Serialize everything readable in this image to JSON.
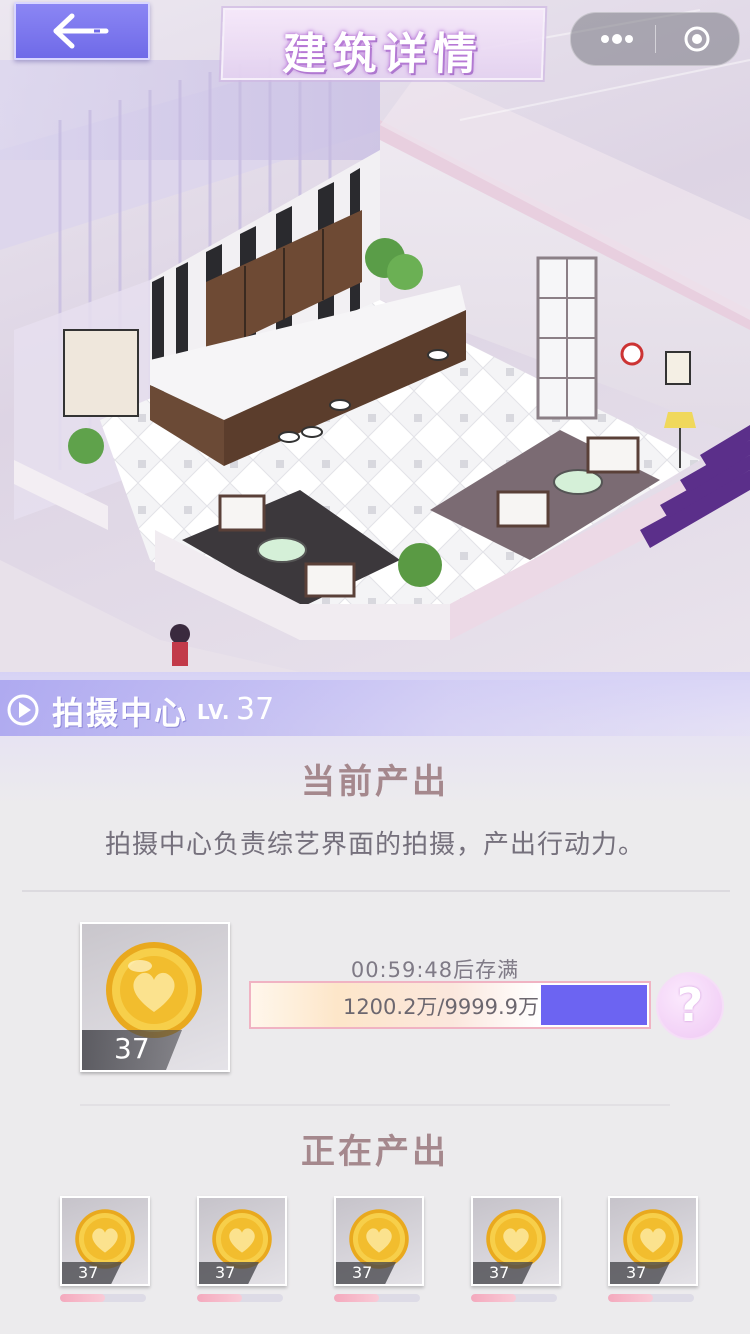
{
  "header": {
    "back_icon": "back-arrow-icon",
    "title": "建筑详情",
    "capsule": {
      "more_icon": "more-dots-icon",
      "close_icon": "target-circle-icon"
    }
  },
  "building": {
    "name": "拍摄中心",
    "level_label": "LV.",
    "level": "37"
  },
  "current_output": {
    "title": "当前产出",
    "description": "拍摄中心负责综艺界面的拍摄，产出行动力。",
    "item": {
      "icon": "gold-heart-coin-icon",
      "level": "37"
    },
    "timer": "00:59:48后存满",
    "storage_text": "1200.2万/9999.9万",
    "storage_current": 1200.2,
    "storage_max": 9999.9,
    "help_label": "?"
  },
  "producing": {
    "title": "正在产出",
    "items": [
      {
        "icon": "gold-heart-coin-icon",
        "level": "37",
        "progress": 0.52
      },
      {
        "icon": "gold-heart-coin-icon",
        "level": "37",
        "progress": 0.52
      },
      {
        "icon": "gold-heart-coin-icon",
        "level": "37",
        "progress": 0.52
      },
      {
        "icon": "gold-heart-coin-icon",
        "level": "37",
        "progress": 0.52
      },
      {
        "icon": "gold-heart-coin-icon",
        "level": "37",
        "progress": 0.52
      }
    ]
  },
  "colors": {
    "accent_purple": "#6c64f2",
    "title_text": "#a5888d",
    "coin_gold": "#f2c23a"
  }
}
